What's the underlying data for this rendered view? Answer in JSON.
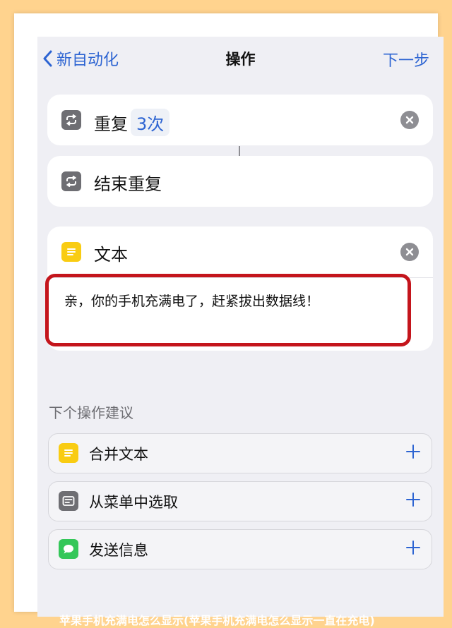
{
  "nav": {
    "back_label": "新自动化",
    "title": "操作",
    "next_label": "下一步"
  },
  "actions": {
    "repeat": {
      "label": "重复",
      "count": "3次",
      "icon": "repeat-icon"
    },
    "end_repeat": {
      "label": "结束重复",
      "icon": "repeat-icon"
    },
    "text": {
      "label": "文本",
      "content": "亲，你的手机充满电了，赶紧拔出数据线！",
      "icon": "text-doc-icon"
    }
  },
  "suggestions": {
    "title": "下个操作建议",
    "items": [
      {
        "label": "合并文本",
        "icon": "text-doc-icon"
      },
      {
        "label": "从菜单中选取",
        "icon": "menu-icon"
      },
      {
        "label": "发送信息",
        "icon": "message-icon"
      }
    ]
  },
  "watermark": "苹果手机充满电怎么显示(苹果手机充满电怎么显示一直在充电)",
  "colors": {
    "accent": "#2D64D2",
    "highlight_border": "#C4151C",
    "page_background": "#FFD38E",
    "screen_background": "#EFEFF4"
  }
}
